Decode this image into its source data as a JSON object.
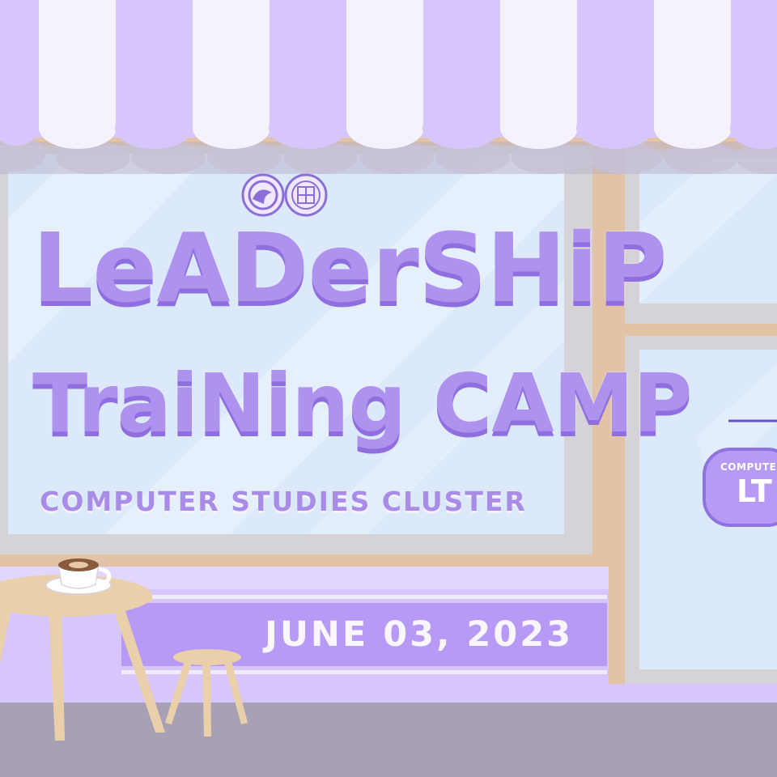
{
  "poster": {
    "title_line_1": "LeADerSHiP",
    "title_line_2": "TraiNing CAMP",
    "subtitle": "COMPUTER STUDIES CLUSTER",
    "date": "JUNE 03, 2023"
  },
  "hanging_sign": {
    "small_text": "COMPUTER",
    "big_text": "LT"
  },
  "colors": {
    "lavender": "#c8b4fa",
    "title_purple": "#ad92ee",
    "window_glass": "#dbe9fb",
    "frame_tan": "#e2c3a5",
    "awning_white": "#f5f2fd",
    "sidewalk": "#a8a0b4"
  },
  "icons": [
    "logo-seal-left",
    "logo-seal-right",
    "coffee-cup-icon",
    "hanging-sign"
  ]
}
